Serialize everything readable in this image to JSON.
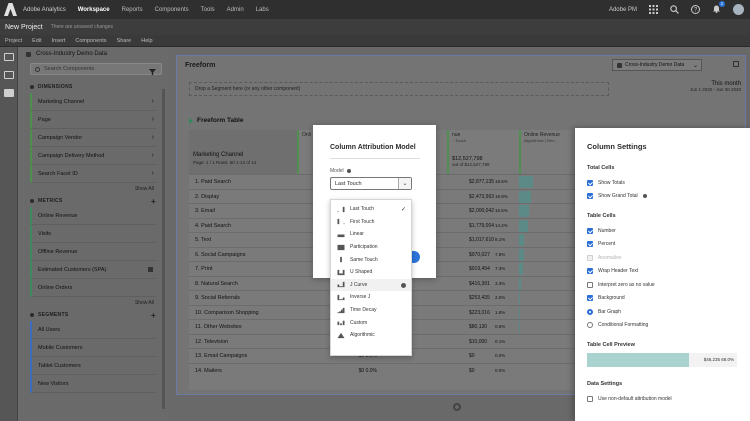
{
  "topbar": {
    "app_name": "Adobe Analytics",
    "nav": [
      "Workspace",
      "Reports",
      "Components",
      "Tools",
      "Admin",
      "Labs"
    ],
    "active_nav": "Workspace",
    "org": "Adobe PM",
    "notification_count": "2"
  },
  "project": {
    "title": "New Project",
    "unsaved": "There are unsaved changes"
  },
  "menubar": [
    "Project",
    "Edit",
    "Insert",
    "Components",
    "Share",
    "Help"
  ],
  "left_panel": {
    "report_suite": "Cross-Industry Demo Data",
    "search_placeholder": "Search Components",
    "dimensions_header": "DIMENSIONS",
    "dimensions": [
      "Marketing Channel",
      "Page",
      "Campaign Vendor",
      "Campaign Delivery Method",
      "Search Facet ID"
    ],
    "metrics_header": "METRICS",
    "metrics": [
      "Online Revenue",
      "Visits",
      "Offline Revenue",
      "Estimated Customers (SPA)",
      "Online Orders"
    ],
    "segments_header": "SEGMENTS",
    "segments": [
      "All Users",
      "Mobile Customers",
      "Tablet Customers",
      "New Visitors"
    ],
    "show_all": "Show All"
  },
  "panel": {
    "title": "Freeform",
    "report_suite": "Cross-Industry Demo Data",
    "dropzone": "Drop a Segment here (or any other component)",
    "date_label": "This month",
    "date_range": "Jun 1 2020 - Jun 30 2020"
  },
  "table": {
    "title": "Freeform Table",
    "dimension": "Marketing Channel",
    "page_info": "Page: 1 / 1  Rows: 50  1-14 of 14",
    "col1_name": "Onli",
    "col2_name": "nue",
    "col2_sub": "...Touch",
    "col2_total": "$12,527,798",
    "col2_total_pct": "out of $12,527,798",
    "col3_name": "Online Revenue",
    "col3_sub": "Algorithmic | Rev...",
    "rows": [
      {
        "name": "1. Paid Search",
        "value": "$2,877,135",
        "pct": "18.6%"
      },
      {
        "name": "2. Display",
        "value": "$2,473,963",
        "pct": "19.9%"
      },
      {
        "name": "3. Email",
        "value": "$2,000,042",
        "pct": "16.5%"
      },
      {
        "name": "4. Paid Search",
        "value": "$1,779,004",
        "pct": "14.2%"
      },
      {
        "name": "5. Text",
        "value": "$1,017,610",
        "pct": "8.1%"
      },
      {
        "name": "6. Social Campaigns",
        "value": "$970,027",
        "pct": "7.8%"
      },
      {
        "name": "7. Print",
        "value": "$919,494",
        "pct": "7.3%"
      },
      {
        "name": "8. Natural Search",
        "value": "$416,391",
        "pct": "3.3%"
      },
      {
        "name": "9. Social Referrals",
        "value": "$253,435",
        "pct": "2.0%"
      },
      {
        "name": "10. Comparison Shopping",
        "value": "$223,016",
        "pct": "1.8%"
      },
      {
        "name": "11. Other Websites",
        "value": "$80,130",
        "pct": "0.6%"
      },
      {
        "name": "12. Television",
        "value": "$10,000",
        "pct": "0.1%"
      },
      {
        "name": "13. Email Campaigns",
        "value": "$0",
        "pct": "0.0%"
      },
      {
        "name": "14. Mailers",
        "value": "$0",
        "pct": "0.0%"
      }
    ],
    "row_col1": [
      "",
      "",
      "",
      "",
      "",
      "",
      "",
      "",
      "",
      "",
      "",
      "",
      "$0",
      "$0"
    ],
    "row_col1_pct": [
      "",
      "",
      "",
      "",
      "",
      "",
      "",
      "",
      "",
      "",
      "",
      "",
      "0.0%",
      "0.0%"
    ],
    "col1_fill": [
      0.0,
      0.0,
      0.0,
      0.0,
      0.0,
      0.0,
      0.0,
      0.0,
      0.0,
      0.0,
      0.0,
      0.0,
      0.0,
      0.0
    ],
    "col3_fill": [
      0.23,
      0.2,
      0.16,
      0.14,
      0.08,
      0.08,
      0.07,
      0.03,
      0.02,
      0.02,
      0.01,
      0.0,
      0.0,
      0.0
    ]
  },
  "modal": {
    "title": "Column Attribution Model",
    "model_label": "Model",
    "selected": "Last Touch"
  },
  "dropdown": {
    "items": [
      {
        "label": "Last Touch",
        "icon": "last-touch-icon",
        "checked": true
      },
      {
        "label": "First Touch",
        "icon": "first-touch-icon"
      },
      {
        "label": "Linear",
        "icon": "linear-icon"
      },
      {
        "label": "Participation",
        "icon": "participation-icon"
      },
      {
        "label": "Same Touch",
        "icon": "same-touch-icon"
      },
      {
        "label": "U Shaped",
        "icon": "u-shaped-icon"
      },
      {
        "label": "J Curve",
        "icon": "j-curve-icon",
        "hover": true,
        "info": true
      },
      {
        "label": "Inverse J",
        "icon": "inverse-j-icon"
      },
      {
        "label": "Time Decay",
        "icon": "time-decay-icon"
      },
      {
        "label": "Custom",
        "icon": "custom-icon"
      },
      {
        "label": "Algorithmic",
        "icon": "algorithmic-icon"
      }
    ]
  },
  "settings": {
    "title": "Column Settings",
    "total_cells": "Total Cells",
    "show_totals": "Show Totals",
    "show_grand_total": "Show Grand Total",
    "table_cells": "Table Cells",
    "number": "Number",
    "percent": "Percent",
    "anomalies": "Anomalies",
    "wrap_header": "Wrap Header Text",
    "interpret_zero": "Interpret zero as no value",
    "background": "Background",
    "bar_graph": "Bar Graph",
    "conditional": "Conditional Formatting",
    "preview_label": "Table Cell Preview",
    "preview_value": "$46,235  68.0%",
    "preview_fill": 0.68,
    "data_settings": "Data Settings",
    "non_default_attr": "Use non-default attribution model"
  }
}
